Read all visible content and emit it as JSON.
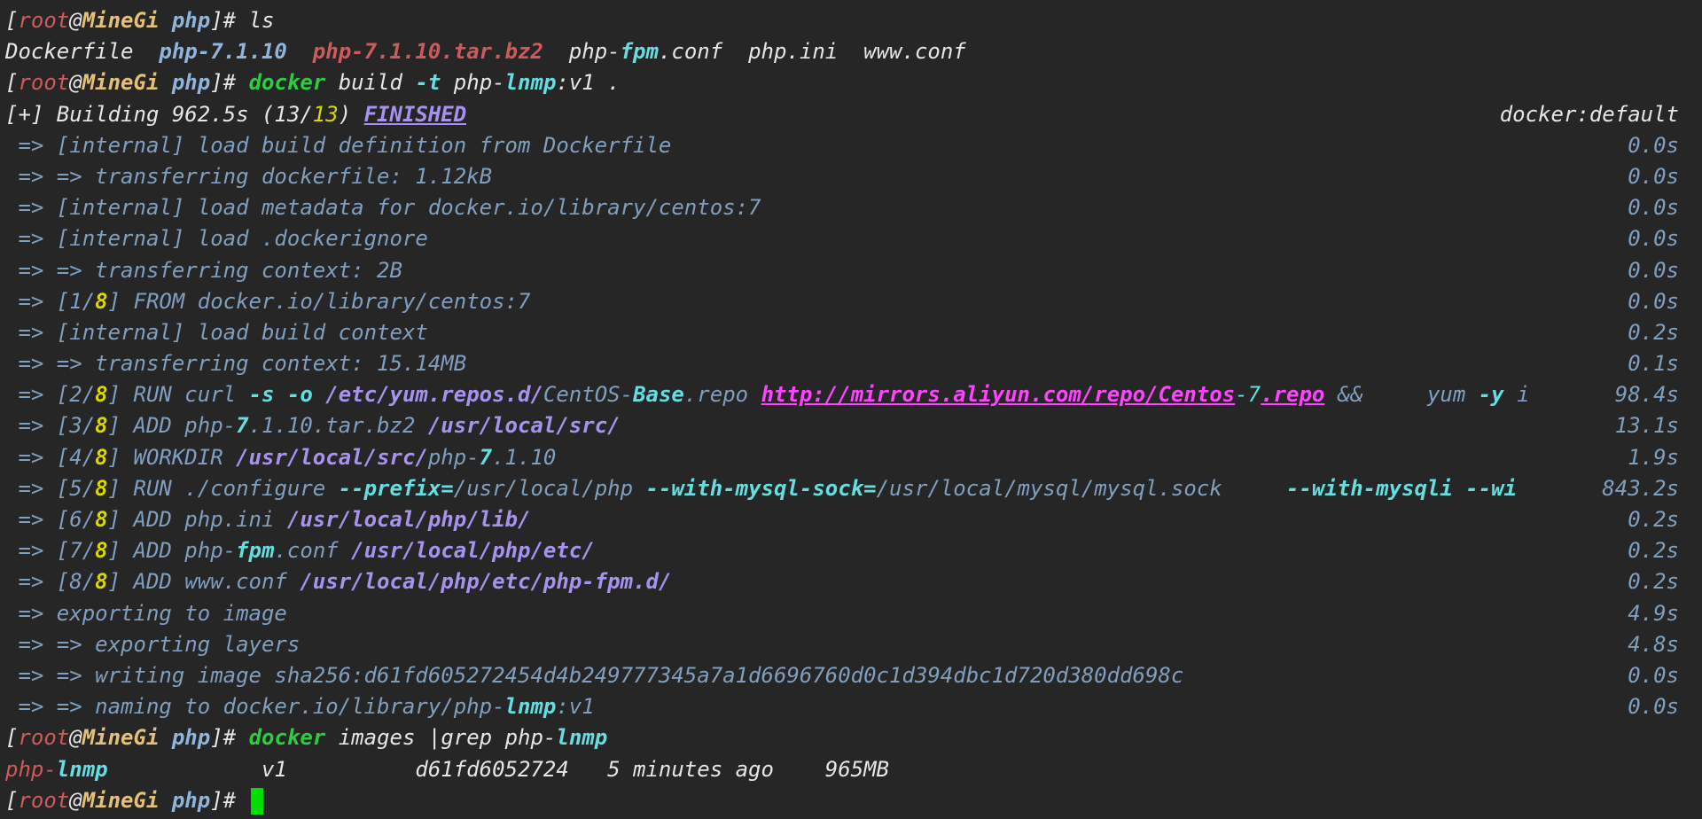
{
  "colors": {
    "background": "#262626",
    "default": "#e6e6e6",
    "red": "#d05a5a",
    "yellow": "#e5c07b",
    "blue": "#8fb5dc",
    "gray": "#7f9fc0",
    "cyan": "#66dde0",
    "green": "#2ecc40",
    "purple": "#a892f0",
    "magenta": "#ff44ff",
    "olive": "#d7d700",
    "cursor": "#00e000"
  },
  "terminal": {
    "lines": [
      {
        "segs": [
          {
            "t": "[",
            "c": "default"
          },
          {
            "t": "root",
            "c": "red"
          },
          {
            "t": "@",
            "c": "default"
          },
          {
            "t": "MineGi",
            "c": "yellow",
            "b": true
          },
          {
            "t": " ",
            "c": "default"
          },
          {
            "t": "php",
            "c": "blue",
            "b": true
          },
          {
            "t": "]# ls",
            "c": "default"
          }
        ]
      },
      {
        "segs": [
          {
            "t": "Dockerfile  ",
            "c": "default"
          },
          {
            "t": "php-7.1.10",
            "c": "blue",
            "b": true
          },
          {
            "t": "  ",
            "c": "default"
          },
          {
            "t": "php-7.1.10.tar.bz2",
            "c": "red",
            "b": true
          },
          {
            "t": "  ",
            "c": "default"
          },
          {
            "t": "php-",
            "c": "default"
          },
          {
            "t": "fpm",
            "c": "cyan",
            "b": true
          },
          {
            "t": ".conf  php.ini  www.conf",
            "c": "default"
          }
        ]
      },
      {
        "segs": [
          {
            "t": "[",
            "c": "default"
          },
          {
            "t": "root",
            "c": "red"
          },
          {
            "t": "@",
            "c": "default"
          },
          {
            "t": "MineGi",
            "c": "yellow",
            "b": true
          },
          {
            "t": " ",
            "c": "default"
          },
          {
            "t": "php",
            "c": "blue",
            "b": true
          },
          {
            "t": "]# ",
            "c": "default"
          },
          {
            "t": "docker",
            "c": "green",
            "b": true
          },
          {
            "t": " build ",
            "c": "default"
          },
          {
            "t": "-t",
            "c": "cyan",
            "b": true
          },
          {
            "t": " php-",
            "c": "default"
          },
          {
            "t": "lnmp",
            "c": "cyan",
            "b": true
          },
          {
            "t": ":v1 .",
            "c": "default"
          }
        ]
      },
      {
        "segs": [
          {
            "t": "[+] Building 962.5s (13/",
            "c": "default"
          },
          {
            "t": "13",
            "c": "olive"
          },
          {
            "t": ") ",
            "c": "default"
          },
          {
            "t": "FINISHED",
            "c": "purple",
            "b": true,
            "u": true
          }
        ],
        "right": [
          {
            "t": "docker:default",
            "c": "default"
          }
        ]
      },
      {
        "segs": [
          {
            "t": " => [internal] load build definition from Dockerfile",
            "c": "gray"
          }
        ],
        "right": [
          {
            "t": "0.0s",
            "c": "gray"
          }
        ]
      },
      {
        "segs": [
          {
            "t": " => => transferring dockerfile: 1.12kB",
            "c": "gray"
          }
        ],
        "right": [
          {
            "t": "0.0s",
            "c": "gray"
          }
        ]
      },
      {
        "segs": [
          {
            "t": " => [internal] load metadata for docker.io/library/centos:7",
            "c": "gray"
          }
        ],
        "right": [
          {
            "t": "0.0s",
            "c": "gray"
          }
        ]
      },
      {
        "segs": [
          {
            "t": " => [internal] load .dockerignore",
            "c": "gray"
          }
        ],
        "right": [
          {
            "t": "0.0s",
            "c": "gray"
          }
        ]
      },
      {
        "segs": [
          {
            "t": " => => transferring context: 2B",
            "c": "gray"
          }
        ],
        "right": [
          {
            "t": "0.0s",
            "c": "gray"
          }
        ]
      },
      {
        "segs": [
          {
            "t": " => [1/",
            "c": "gray"
          },
          {
            "t": "8",
            "c": "olive",
            "b": true
          },
          {
            "t": "] FROM docker.io/library/centos:7",
            "c": "gray"
          }
        ],
        "right": [
          {
            "t": "0.0s",
            "c": "gray"
          }
        ]
      },
      {
        "segs": [
          {
            "t": " => [internal] load build context",
            "c": "gray"
          }
        ],
        "right": [
          {
            "t": "0.2s",
            "c": "gray"
          }
        ]
      },
      {
        "segs": [
          {
            "t": " => => transferring context: 15.14MB",
            "c": "gray"
          }
        ],
        "right": [
          {
            "t": "0.1s",
            "c": "gray"
          }
        ]
      },
      {
        "segs": [
          {
            "t": " => [2/",
            "c": "gray"
          },
          {
            "t": "8",
            "c": "olive",
            "b": true
          },
          {
            "t": "] RUN curl ",
            "c": "gray"
          },
          {
            "t": "-s -o",
            "c": "cyan",
            "b": true
          },
          {
            "t": " ",
            "c": "gray"
          },
          {
            "t": "/etc/yum.repos.d/",
            "c": "purple",
            "b": true
          },
          {
            "t": "CentOS-",
            "c": "gray"
          },
          {
            "t": "Base",
            "c": "cyan",
            "b": true
          },
          {
            "t": ".repo ",
            "c": "gray"
          },
          {
            "t": "http://mirrors.aliyun.com/repo/Centos",
            "c": "magenta",
            "b": true,
            "u": true
          },
          {
            "t": "-7",
            "c": "cyan"
          },
          {
            "t": ".repo",
            "c": "magenta",
            "b": true,
            "u": true
          },
          {
            "t": " && ",
            "c": "gray"
          },
          {
            "t": "    yum ",
            "c": "gray"
          },
          {
            "t": "-y",
            "c": "cyan",
            "b": true
          },
          {
            "t": " i",
            "c": "gray"
          }
        ],
        "right": [
          {
            "t": "98.4s",
            "c": "gray"
          }
        ]
      },
      {
        "segs": [
          {
            "t": " => [3/",
            "c": "gray"
          },
          {
            "t": "8",
            "c": "olive",
            "b": true
          },
          {
            "t": "] ADD php-",
            "c": "gray"
          },
          {
            "t": "7",
            "c": "cyan",
            "b": true
          },
          {
            "t": ".1.10.tar.bz2 ",
            "c": "gray"
          },
          {
            "t": "/usr/local/src/",
            "c": "purple",
            "b": true
          }
        ],
        "right": [
          {
            "t": "13.1s",
            "c": "gray"
          }
        ]
      },
      {
        "segs": [
          {
            "t": " => [4/",
            "c": "gray"
          },
          {
            "t": "8",
            "c": "olive",
            "b": true
          },
          {
            "t": "] WORKDIR ",
            "c": "gray"
          },
          {
            "t": "/usr/local/src/",
            "c": "purple",
            "b": true
          },
          {
            "t": "php-",
            "c": "gray"
          },
          {
            "t": "7",
            "c": "cyan",
            "b": true
          },
          {
            "t": ".1.10",
            "c": "gray"
          }
        ],
        "right": [
          {
            "t": "1.9s",
            "c": "gray"
          }
        ]
      },
      {
        "segs": [
          {
            "t": " => [5/",
            "c": "gray"
          },
          {
            "t": "8",
            "c": "olive",
            "b": true
          },
          {
            "t": "] RUN ./configure ",
            "c": "gray"
          },
          {
            "t": "--prefix=",
            "c": "cyan",
            "b": true
          },
          {
            "t": "/usr/local/php ",
            "c": "gray"
          },
          {
            "t": "--with-mysql-sock=",
            "c": "cyan",
            "b": true
          },
          {
            "t": "/usr/local/mysql/mysql.sock     ",
            "c": "gray"
          },
          {
            "t": "--with-mysqli --wi",
            "c": "cyan",
            "b": true
          }
        ],
        "right": [
          {
            "t": "843.2s",
            "c": "gray"
          }
        ]
      },
      {
        "segs": [
          {
            "t": " => [6/",
            "c": "gray"
          },
          {
            "t": "8",
            "c": "olive",
            "b": true
          },
          {
            "t": "] ADD php.ini ",
            "c": "gray"
          },
          {
            "t": "/usr/local/php/lib/",
            "c": "purple",
            "b": true
          }
        ],
        "right": [
          {
            "t": "0.2s",
            "c": "gray"
          }
        ]
      },
      {
        "segs": [
          {
            "t": " => [7/",
            "c": "gray"
          },
          {
            "t": "8",
            "c": "olive",
            "b": true
          },
          {
            "t": "] ADD php-",
            "c": "gray"
          },
          {
            "t": "fpm",
            "c": "cyan",
            "b": true
          },
          {
            "t": ".conf ",
            "c": "gray"
          },
          {
            "t": "/usr/local/php/etc/",
            "c": "purple",
            "b": true
          }
        ],
        "right": [
          {
            "t": "0.2s",
            "c": "gray"
          }
        ]
      },
      {
        "segs": [
          {
            "t": " => [8/",
            "c": "gray"
          },
          {
            "t": "8",
            "c": "olive",
            "b": true
          },
          {
            "t": "] ADD www.conf ",
            "c": "gray"
          },
          {
            "t": "/usr/local/php/etc/php-fpm.d/",
            "c": "purple",
            "b": true
          }
        ],
        "right": [
          {
            "t": "0.2s",
            "c": "gray"
          }
        ]
      },
      {
        "segs": [
          {
            "t": " => exporting to image",
            "c": "gray"
          }
        ],
        "right": [
          {
            "t": "4.9s",
            "c": "gray"
          }
        ]
      },
      {
        "segs": [
          {
            "t": " => => exporting layers",
            "c": "gray"
          }
        ],
        "right": [
          {
            "t": "4.8s",
            "c": "gray"
          }
        ]
      },
      {
        "segs": [
          {
            "t": " => => writing image sha256:d61fd605272454d4b249777345a7a1d6696760d0c1d394dbc1d720d380dd698c",
            "c": "gray"
          }
        ],
        "right": [
          {
            "t": "0.0s",
            "c": "gray"
          }
        ]
      },
      {
        "segs": [
          {
            "t": " => => naming to docker.io/library/php-",
            "c": "gray"
          },
          {
            "t": "lnmp",
            "c": "cyan",
            "b": true
          },
          {
            "t": ":v1",
            "c": "gray"
          }
        ],
        "right": [
          {
            "t": "0.0s",
            "c": "gray"
          }
        ]
      },
      {
        "segs": [
          {
            "t": "[",
            "c": "default"
          },
          {
            "t": "root",
            "c": "red"
          },
          {
            "t": "@",
            "c": "default"
          },
          {
            "t": "MineGi",
            "c": "yellow",
            "b": true
          },
          {
            "t": " ",
            "c": "default"
          },
          {
            "t": "php",
            "c": "blue",
            "b": true
          },
          {
            "t": "]# ",
            "c": "default"
          },
          {
            "t": "docker",
            "c": "green",
            "b": true
          },
          {
            "t": " images |grep php-",
            "c": "default"
          },
          {
            "t": "lnmp",
            "c": "cyan",
            "b": true
          }
        ]
      },
      {
        "segs": [
          {
            "t": "php-",
            "c": "red"
          },
          {
            "t": "lnmp",
            "c": "cyan",
            "b": true
          },
          {
            "t": "            v1          d61fd6052724   5 minutes ago    965MB",
            "c": "default"
          }
        ]
      },
      {
        "segs": [
          {
            "t": "[",
            "c": "default"
          },
          {
            "t": "root",
            "c": "red"
          },
          {
            "t": "@",
            "c": "default"
          },
          {
            "t": "MineGi",
            "c": "yellow",
            "b": true
          },
          {
            "t": " ",
            "c": "default"
          },
          {
            "t": "php",
            "c": "blue",
            "b": true
          },
          {
            "t": "]# ",
            "c": "default"
          }
        ],
        "cursor": true
      }
    ]
  }
}
